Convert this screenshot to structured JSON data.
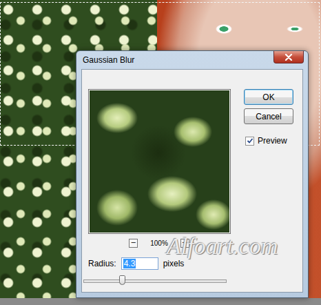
{
  "window": {
    "title": "Gaussian Blur"
  },
  "preview": {
    "zoom": "100%",
    "zoom_out": "−",
    "zoom_in": "+"
  },
  "radius": {
    "label": "Radius:",
    "value": "4.3",
    "unit": "pixels",
    "level": 0.27
  },
  "buttons": [
    {
      "label": "OK",
      "default": true
    },
    {
      "label": "Cancel",
      "default": false
    }
  ],
  "preview_checkbox": {
    "label": "Preview",
    "checked": true
  },
  "watermark": "Alfoart.com"
}
